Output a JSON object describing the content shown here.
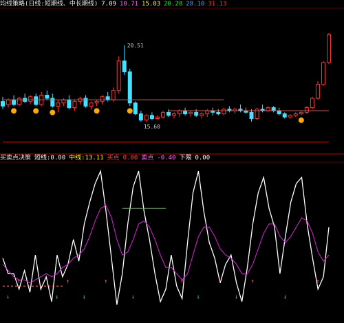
{
  "top_panel": {
    "legend": [
      {
        "text": "均线策略(日线:短期线、中长期线)",
        "color": "#e8e8e8"
      },
      {
        "text": "7.09",
        "color": "#ffffff"
      },
      {
        "text": "10.71",
        "color": "#ff66ff"
      },
      {
        "text": "15.03",
        "color": "#ffff00"
      },
      {
        "text": "20.28",
        "color": "#00ff00"
      },
      {
        "text": "28.10",
        "color": "#5599ff"
      },
      {
        "text": "31.13",
        "color": "#ff3333"
      }
    ],
    "price_high_label": "20.51",
    "price_low_label": "15.60"
  },
  "bottom_panel": {
    "legend": [
      {
        "text": "买卖点决策",
        "color": "#e8e8e8"
      },
      {
        "text": "短线:0.00",
        "color": "#ffffff"
      },
      {
        "text": "中线:13.11",
        "color": "#ffff00"
      },
      {
        "text": "买点",
        "color": "#ff4444"
      },
      {
        "text": "0.00",
        "color": "#ff4444"
      },
      {
        "text": "卖点",
        "color": "#ff66ff"
      },
      {
        "text": "-0.40",
        "color": "#ff66ff"
      },
      {
        "text": "下限",
        "color": "#ffffff"
      },
      {
        "text": "0.00",
        "color": "#ffffff"
      }
    ]
  },
  "chart_data": [
    {
      "type": "candlestick",
      "panel": "price",
      "candles": [
        {
          "o": 16.9,
          "h": 17.2,
          "l": 16.4,
          "c": 16.6
        },
        {
          "o": 16.7,
          "h": 17.1,
          "l": 16.5,
          "c": 17.0
        },
        {
          "o": 17.0,
          "h": 17.3,
          "l": 16.6,
          "c": 16.7
        },
        {
          "o": 16.7,
          "h": 17.2,
          "l": 16.6,
          "c": 17.1
        },
        {
          "o": 17.1,
          "h": 17.4,
          "l": 16.8,
          "c": 16.9
        },
        {
          "o": 16.9,
          "h": 17.3,
          "l": 16.7,
          "c": 17.2
        },
        {
          "o": 17.2,
          "h": 17.4,
          "l": 16.6,
          "c": 16.7
        },
        {
          "o": 16.7,
          "h": 17.5,
          "l": 16.6,
          "c": 17.3
        },
        {
          "o": 17.3,
          "h": 17.6,
          "l": 17.0,
          "c": 17.1
        },
        {
          "o": 17.1,
          "h": 17.4,
          "l": 16.5,
          "c": 16.6
        },
        {
          "o": 16.6,
          "h": 17.0,
          "l": 16.2,
          "c": 16.8
        },
        {
          "o": 16.8,
          "h": 17.1,
          "l": 16.6,
          "c": 17.0
        },
        {
          "o": 17.0,
          "h": 17.3,
          "l": 16.4,
          "c": 16.5
        },
        {
          "o": 16.5,
          "h": 17.0,
          "l": 16.3,
          "c": 16.9
        },
        {
          "o": 16.9,
          "h": 17.2,
          "l": 16.7,
          "c": 17.1
        },
        {
          "o": 17.1,
          "h": 17.3,
          "l": 16.5,
          "c": 16.6
        },
        {
          "o": 16.6,
          "h": 16.9,
          "l": 16.4,
          "c": 16.8
        },
        {
          "o": 16.8,
          "h": 17.0,
          "l": 16.6,
          "c": 16.9
        },
        {
          "o": 16.9,
          "h": 17.3,
          "l": 16.7,
          "c": 17.2
        },
        {
          "o": 17.2,
          "h": 17.5,
          "l": 16.9,
          "c": 17.0
        },
        {
          "o": 17.0,
          "h": 17.8,
          "l": 16.9,
          "c": 17.6
        },
        {
          "o": 17.6,
          "h": 19.8,
          "l": 17.4,
          "c": 19.5
        },
        {
          "o": 19.5,
          "h": 20.51,
          "l": 18.6,
          "c": 18.8
        },
        {
          "o": 18.8,
          "h": 19.0,
          "l": 16.6,
          "c": 16.8
        },
        {
          "o": 16.8,
          "h": 16.9,
          "l": 16.0,
          "c": 16.1
        },
        {
          "o": 16.1,
          "h": 16.3,
          "l": 15.6,
          "c": 15.7
        },
        {
          "o": 15.7,
          "h": 16.1,
          "l": 15.6,
          "c": 16.0
        },
        {
          "o": 16.0,
          "h": 16.2,
          "l": 15.7,
          "c": 15.8
        },
        {
          "o": 15.8,
          "h": 16.0,
          "l": 15.7,
          "c": 15.9
        },
        {
          "o": 15.9,
          "h": 16.3,
          "l": 15.8,
          "c": 16.2
        },
        {
          "o": 16.2,
          "h": 16.4,
          "l": 15.9,
          "c": 16.0
        },
        {
          "o": 16.0,
          "h": 16.2,
          "l": 15.8,
          "c": 16.1
        },
        {
          "o": 16.1,
          "h": 16.4,
          "l": 15.9,
          "c": 16.3
        },
        {
          "o": 16.3,
          "h": 16.5,
          "l": 16.0,
          "c": 16.1
        },
        {
          "o": 16.1,
          "h": 16.3,
          "l": 15.9,
          "c": 16.2
        },
        {
          "o": 16.2,
          "h": 16.4,
          "l": 15.9,
          "c": 16.0
        },
        {
          "o": 16.0,
          "h": 16.2,
          "l": 15.8,
          "c": 16.1
        },
        {
          "o": 16.1,
          "h": 16.4,
          "l": 15.9,
          "c": 16.3
        },
        {
          "o": 16.3,
          "h": 16.5,
          "l": 16.0,
          "c": 16.2
        },
        {
          "o": 16.2,
          "h": 16.4,
          "l": 16.0,
          "c": 16.1
        },
        {
          "o": 16.1,
          "h": 16.5,
          "l": 16.0,
          "c": 16.4
        },
        {
          "o": 16.4,
          "h": 16.6,
          "l": 16.2,
          "c": 16.3
        },
        {
          "o": 16.3,
          "h": 16.5,
          "l": 16.1,
          "c": 16.4
        },
        {
          "o": 16.4,
          "h": 16.7,
          "l": 16.2,
          "c": 16.3
        },
        {
          "o": 16.3,
          "h": 16.5,
          "l": 16.1,
          "c": 16.2
        },
        {
          "o": 16.2,
          "h": 16.4,
          "l": 15.6,
          "c": 15.8
        },
        {
          "o": 15.8,
          "h": 16.5,
          "l": 15.7,
          "c": 16.4
        },
        {
          "o": 16.4,
          "h": 16.7,
          "l": 16.2,
          "c": 16.3
        },
        {
          "o": 16.3,
          "h": 16.6,
          "l": 16.2,
          "c": 16.5
        },
        {
          "o": 16.5,
          "h": 16.6,
          "l": 16.2,
          "c": 16.3
        },
        {
          "o": 16.3,
          "h": 16.5,
          "l": 16.0,
          "c": 16.1
        },
        {
          "o": 16.1,
          "h": 16.2,
          "l": 15.8,
          "c": 15.9
        },
        {
          "o": 15.9,
          "h": 16.1,
          "l": 15.8,
          "c": 16.0
        },
        {
          "o": 16.0,
          "h": 16.2,
          "l": 15.9,
          "c": 16.1
        },
        {
          "o": 16.1,
          "h": 16.3,
          "l": 16.0,
          "c": 16.2
        },
        {
          "o": 16.2,
          "h": 16.6,
          "l": 16.1,
          "c": 16.5
        },
        {
          "o": 16.5,
          "h": 17.2,
          "l": 16.4,
          "c": 17.1
        },
        {
          "o": 17.1,
          "h": 18.2,
          "l": 17.0,
          "c": 18.0
        },
        {
          "o": 18.0,
          "h": 19.5,
          "l": 17.9,
          "c": 19.4
        },
        {
          "o": 19.4,
          "h": 21.3,
          "l": 19.3,
          "c": 21.2
        }
      ],
      "ylim": [
        13.7,
        22.8
      ],
      "dividers": [
        17.0,
        16.3
      ],
      "buy_marks": [
        2,
        6,
        9,
        17,
        23,
        54
      ]
    },
    {
      "type": "line",
      "panel": "indicator",
      "ylim": [
        0,
        100
      ],
      "series": [
        {
          "values": [
            40,
            30,
            30,
            20,
            32,
            18,
            42,
            20,
            28,
            12,
            42,
            28,
            36,
            52,
            38,
            62,
            76,
            88,
            96,
            70,
            40,
            10,
            30,
            62,
            86,
            96,
            70,
            52,
            30,
            12,
            20,
            42,
            22,
            14,
            50,
            82,
            96,
            70,
            50,
            40,
            24,
            36,
            42,
            24,
            12,
            34,
            62,
            82,
            92,
            72,
            60,
            30,
            54,
            76,
            88,
            92,
            62,
            40,
            20,
            28,
            60
          ],
          "color": "#ffffff"
        },
        {
          "values": [
            36,
            32,
            28,
            26,
            26,
            24,
            26,
            28,
            30,
            28,
            30,
            34,
            36,
            40,
            42,
            46,
            54,
            64,
            72,
            74,
            66,
            52,
            42,
            44,
            52,
            62,
            64,
            60,
            52,
            42,
            34,
            34,
            30,
            26,
            30,
            42,
            54,
            60,
            60,
            54,
            46,
            42,
            40,
            36,
            30,
            30,
            36,
            46,
            56,
            62,
            62,
            54,
            50,
            54,
            60,
            66,
            64,
            56,
            44,
            38,
            42
          ],
          "color": "#e020e0"
        },
        {
          "values": [
            72,
            72,
            72,
            72,
            72,
            72,
            72,
            72,
            72
          ],
          "color": "#33cc33",
          "start": 22
        },
        {
          "values": [
            22,
            22,
            22,
            22,
            22,
            22,
            22,
            22,
            22,
            22,
            22,
            22
          ],
          "color": "#ff8888",
          "start": 0
        }
      ],
      "buy_points": [
        3,
        12,
        19,
        33,
        40,
        46,
        58
      ],
      "sell_points": [
        1,
        10,
        15,
        24,
        36,
        43,
        52
      ]
    }
  ]
}
